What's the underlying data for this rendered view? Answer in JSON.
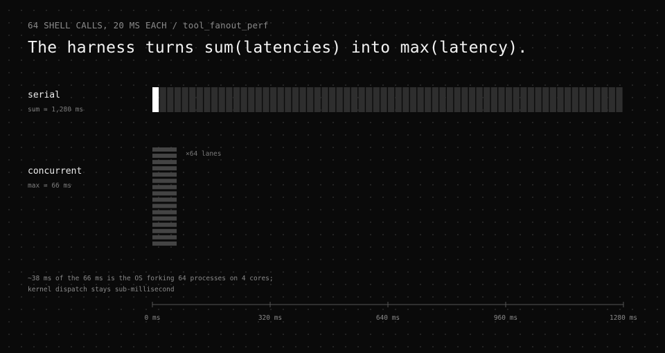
{
  "header": {
    "eyebrow": "64 SHELL CALLS, 20 MS EACH / tool_fanout_perf",
    "headline": "The harness turns sum(latencies) into max(latency)."
  },
  "rows": {
    "serial": {
      "label": "serial",
      "sub": "sum = 1,280 ms"
    },
    "concurrent": {
      "label": "concurrent",
      "sub": "max = 66 ms",
      "lanes_label": "×64 lanes"
    }
  },
  "note": {
    "line1": "~38 ms of the 66 ms is the OS forking 64 processes on 4 cores;",
    "line2": "kernel dispatch stays sub-millisecond"
  },
  "chart_data": {
    "type": "bar",
    "x_unit": "ms",
    "xlim": [
      0,
      1280
    ],
    "x_ticks": [
      0,
      320,
      640,
      960,
      1280
    ],
    "x_tick_labels": [
      "0 ms",
      "320 ms",
      "640 ms",
      "960 ms",
      "1280 ms"
    ],
    "series": [
      {
        "name": "serial",
        "calls": 64,
        "call_ms": 20,
        "total_ms": 1280
      },
      {
        "name": "concurrent",
        "lanes": 64,
        "total_ms": 66
      }
    ],
    "colors": {
      "highlight": "#ffffff",
      "serial_segment": "#2e2e2e",
      "lane": "#444444",
      "axis": "#555555"
    }
  }
}
